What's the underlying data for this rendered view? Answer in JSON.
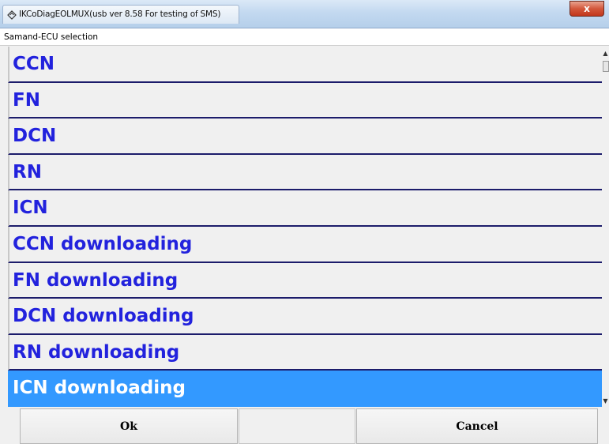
{
  "window": {
    "title": "IKCoDiagEOLMUX(usb ver 8.58 For testing of SMS)",
    "close_glyph": "x",
    "app_icon": "diagnostic-app-icon"
  },
  "dialog": {
    "caption": "Samand-ECU selection"
  },
  "list": {
    "items": [
      {
        "label": "CCN",
        "selected": false
      },
      {
        "label": "FN",
        "selected": false
      },
      {
        "label": "DCN",
        "selected": false
      },
      {
        "label": "RN",
        "selected": false
      },
      {
        "label": "ICN",
        "selected": false
      },
      {
        "label": "CCN downloading",
        "selected": false
      },
      {
        "label": "FN downloading",
        "selected": false
      },
      {
        "label": "DCN downloading",
        "selected": false
      },
      {
        "label": "RN downloading",
        "selected": false
      },
      {
        "label": "ICN downloading",
        "selected": true
      }
    ]
  },
  "buttons": {
    "ok_label": "Ok",
    "cancel_label": "Cancel"
  },
  "colors": {
    "item_text": "#2222dd",
    "selected_bg": "#3399ff",
    "separator": "#1c1c6b"
  }
}
